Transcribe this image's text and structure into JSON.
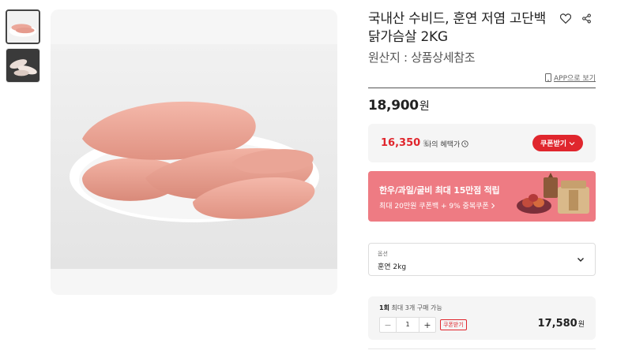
{
  "product": {
    "title": "국내산 수비드, 훈연 저염 고단백 닭가슴살 2KG",
    "origin": "원산지 : 상품상세참조",
    "price": "18,900",
    "currency": "원"
  },
  "app_link": {
    "label": "APP으로 보기"
  },
  "benefit": {
    "price": "16,350",
    "unit": "원",
    "label": "나의 혜택가",
    "coupon_button": "쿠폰받기"
  },
  "banner": {
    "title": "한우/과일/굴비 최대 15만점 적립",
    "subtitle": "최대 20만원 쿠폰백 + 9% 중복쿠폰",
    "bg_color": "#ee7b83"
  },
  "option": {
    "label": "옵션",
    "value": "훈연 2kg"
  },
  "quantity": {
    "note_prefix": "1회",
    "note_max": "최대 3개",
    "note_suffix": "구매 가능",
    "value": "1",
    "minus": "−",
    "plus": "+",
    "coupon_tag": "쿠폰받기",
    "item_price": "17,580",
    "unit": "원"
  },
  "colors": {
    "accent_red": "#e0262d",
    "text": "#222222"
  }
}
